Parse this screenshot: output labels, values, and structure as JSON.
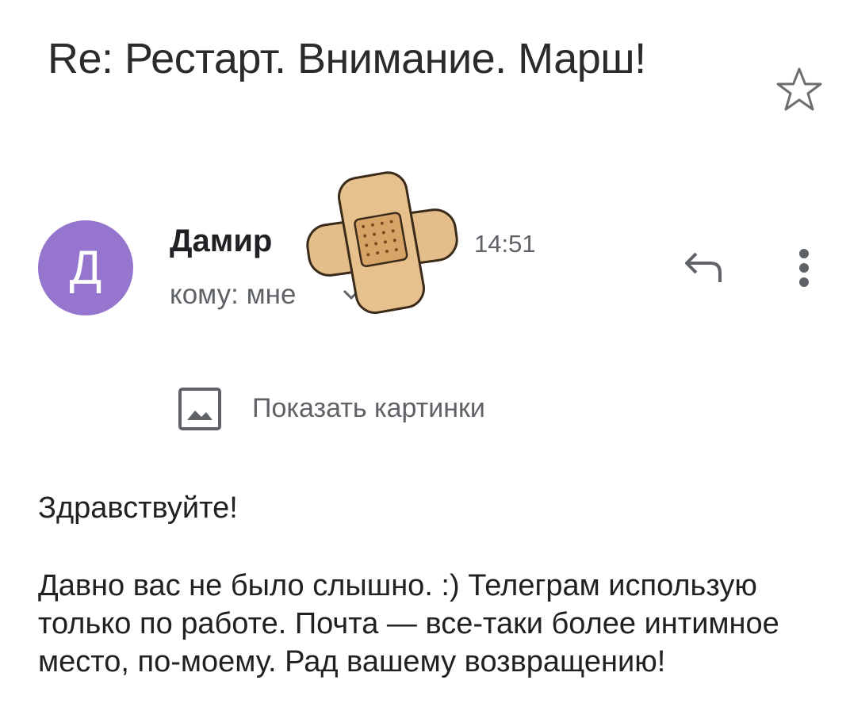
{
  "email": {
    "subject": "Re: Рестарт. Внимание. Марш!",
    "sender": {
      "avatar_letter": "Д",
      "name": "Дамир",
      "time": "14:51",
      "recipients": "кому: мне"
    },
    "show_images_label": "Показать картинки",
    "body": {
      "greeting": "Здравствуйте!",
      "paragraph": "Давно вас не было слышно. :) Телеграм использую только по работе. Почта — все-таки более интимное место, по-моему. Рад вашему возвращению!"
    }
  },
  "colors": {
    "avatar_bg": "#9575cd",
    "secondary_text": "#5f6368",
    "plaster": "#e3bd8a"
  },
  "icons": {
    "star": "star-outline-icon",
    "reply": "reply-icon",
    "more": "more-vert-icon",
    "image": "image-icon",
    "chevron": "chevron-down-icon",
    "redaction": "bandage-sticker"
  }
}
